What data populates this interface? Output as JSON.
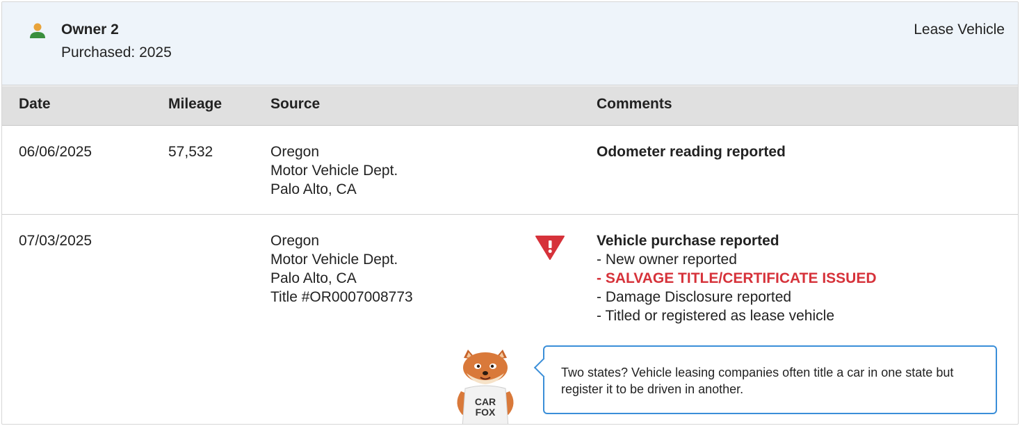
{
  "owner": {
    "icon": "person-icon",
    "title": "Owner 2",
    "purchased": "Purchased: 2025",
    "type": "Lease Vehicle",
    "icon_colors": {
      "head": "#e8a33a",
      "body": "#3a8f3d"
    }
  },
  "table": {
    "headers": {
      "date": "Date",
      "mileage": "Mileage",
      "source": "Source",
      "comments": "Comments"
    },
    "rows": [
      {
        "date": "06/06/2025",
        "mileage": "57,532",
        "source": [
          "Oregon",
          "Motor Vehicle Dept.",
          "Palo Alto, CA"
        ],
        "comments_title": "Odometer reading reported"
      },
      {
        "date": "07/03/2025",
        "mileage": "",
        "source": [
          "Oregon",
          "Motor Vehicle Dept.",
          "Palo Alto, CA",
          "Title #OR0007008773"
        ],
        "alert_icon": "warning-triangle-icon",
        "comments_title": "Vehicle purchase reported",
        "comments": [
          "- New owner reported",
          "- SALVAGE TITLE/CERTIFICATE ISSUED",
          "- Damage Disclosure reported",
          "- Titled or registered as lease vehicle"
        ]
      }
    ]
  },
  "tip": {
    "mascot": "car-fox-mascot",
    "mascot_shirt": [
      "CAR",
      "FOX"
    ],
    "text": "Two states? Vehicle leasing companies often title a car in one state but register it to be driven in another."
  },
  "colors": {
    "header_bg": "#eef4fa",
    "table_head_bg": "#e0e0e0",
    "alert": "#d6323a",
    "bubble_border": "#3a8ed8"
  }
}
